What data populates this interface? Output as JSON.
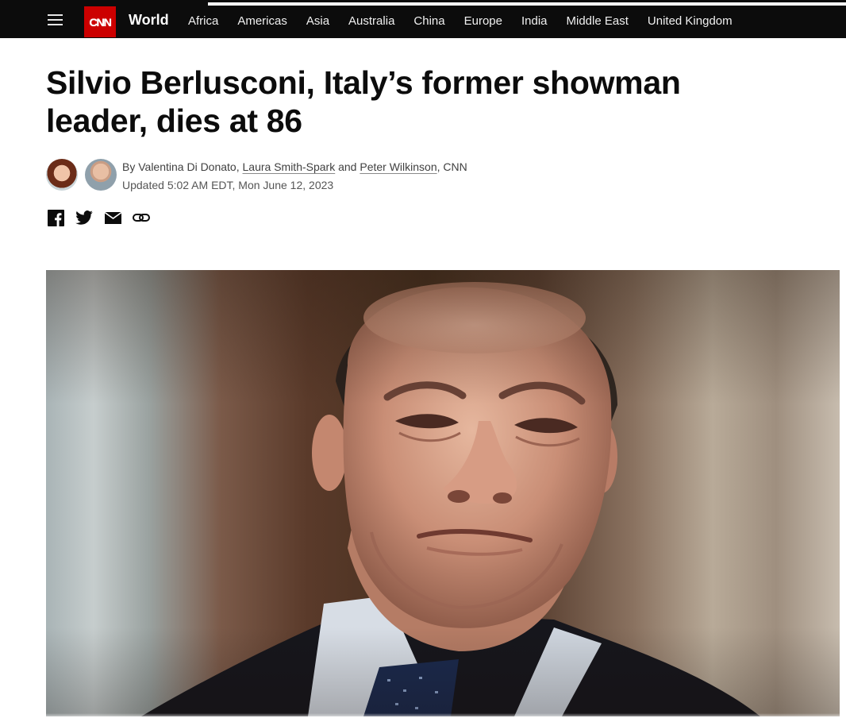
{
  "brand": {
    "logo_text": "CNN",
    "accent": "#cc0000"
  },
  "nav": {
    "section": "World",
    "items": [
      "Africa",
      "Americas",
      "Asia",
      "Australia",
      "China",
      "Europe",
      "India",
      "Middle East",
      "United Kingdom"
    ]
  },
  "article": {
    "headline": "Silvio Berlusconi, Italy’s former showman leader, dies at 86",
    "byline": {
      "prefix": "By",
      "author1": "Valentina Di Donato",
      "sep1": ",",
      "author2": "Laura Smith-Spark",
      "and": "and",
      "author3": "Peter Wilkinson",
      "suffix": ", CNN"
    },
    "timestamp": "Updated 5:02 AM EDT, Mon June 12, 2023"
  },
  "share": {
    "icons": [
      "facebook-icon",
      "twitter-icon",
      "email-icon",
      "link-icon"
    ]
  }
}
